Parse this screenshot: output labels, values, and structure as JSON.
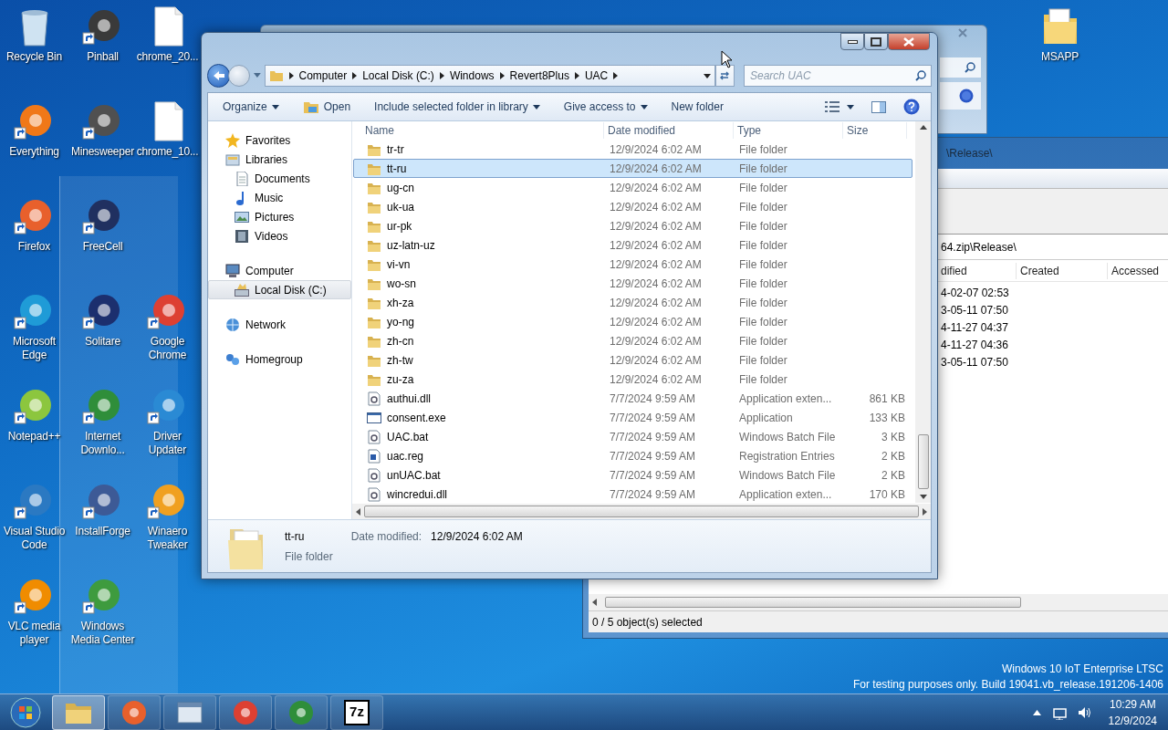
{
  "desktop_icon_columns": [
    [
      {
        "label": "Recycle Bin",
        "kind": "bin",
        "shortcut": false
      },
      {
        "label": "Everything",
        "kind": "app",
        "color": "#f07818",
        "shortcut": true
      },
      {
        "label": "Firefox",
        "kind": "app",
        "color": "#e8602c",
        "shortcut": true
      },
      {
        "label": "Microsoft Edge",
        "kind": "app",
        "color": "#1f9bd7",
        "shortcut": true
      },
      {
        "label": "Notepad++",
        "kind": "app",
        "color": "#8cc63e",
        "shortcut": true
      },
      {
        "label": "Visual Studio Code",
        "kind": "app",
        "color": "#2b79c2",
        "shortcut": true
      },
      {
        "label": "VLC media player",
        "kind": "app",
        "color": "#f08c00",
        "shortcut": true
      }
    ],
    [
      {
        "label": "Pinball",
        "kind": "app",
        "color": "#3a3a3a",
        "shortcut": true
      },
      {
        "label": "Minesweeper",
        "kind": "app",
        "color": "#505050",
        "shortcut": true
      },
      {
        "label": "FreeCell",
        "kind": "app",
        "color": "#203060",
        "shortcut": true
      },
      {
        "label": "Solitare",
        "kind": "app",
        "color": "#1c2f6e",
        "shortcut": true
      },
      {
        "label": "Internet Downlo...",
        "kind": "app",
        "color": "#2f8e3a",
        "shortcut": true
      },
      {
        "label": "InstallForge",
        "kind": "app",
        "color": "#3d5a96",
        "shortcut": true
      },
      {
        "label": "Windows Media Center",
        "kind": "app",
        "color": "#3e9b3e",
        "shortcut": true
      }
    ],
    [
      {
        "label": "chrome_20...",
        "kind": "file",
        "shortcut": false
      },
      {
        "label": "chrome_10...",
        "kind": "file",
        "shortcut": false
      },
      {
        "label": "Google Chrome",
        "kind": "app",
        "color": "#dd4032",
        "shortcut": true
      },
      {
        "label": "Driver Updater",
        "kind": "app",
        "color": "#2a8ad4",
        "shortcut": true
      },
      {
        "label": "Winaero Tweaker",
        "kind": "app",
        "color": "#f0a020",
        "shortcut": true
      }
    ]
  ],
  "desktop_icon_right": {
    "label": "MSAPP",
    "kind": "folder",
    "shortcut": false
  },
  "archive_window": {
    "title": "\\Release\\",
    "path": "64.zip\\Release\\",
    "columns": [
      "dified",
      "Created",
      "Accessed"
    ],
    "rows": [
      "4-02-07 02:53",
      "3-05-11 07:50",
      "4-11-27 04:37",
      "4-11-27 04:36",
      "3-05-11 07:50"
    ],
    "status": "0 / 5 object(s) selected"
  },
  "explorer": {
    "breadcrumbs": [
      "Computer",
      "Local Disk (C:)",
      "Windows",
      "Revert8Plus",
      "UAC"
    ],
    "search": {
      "placeholder": "Search UAC"
    },
    "toolbar": [
      {
        "label": "Organize",
        "dropdown": true,
        "icon": false
      },
      {
        "label": "Open",
        "dropdown": false,
        "icon": true
      },
      {
        "label": "Include selected folder in library",
        "dropdown": true,
        "icon": false
      },
      {
        "label": "Give access to",
        "dropdown": true,
        "icon": false
      },
      {
        "label": "New folder",
        "dropdown": false,
        "icon": false
      }
    ],
    "nav": [
      {
        "label": "Favorites",
        "kind": "star",
        "selected": false
      },
      {
        "label": "Libraries",
        "kind": "library",
        "selected": false,
        "children": [
          {
            "label": "Documents",
            "kind": "document",
            "selected": false
          },
          {
            "label": "Music",
            "kind": "music",
            "selected": false
          },
          {
            "label": "Pictures",
            "kind": "picture",
            "selected": false
          },
          {
            "label": "Videos",
            "kind": "video",
            "selected": false
          }
        ]
      },
      {
        "label": "Computer",
        "kind": "computer",
        "selected": false,
        "children": [
          {
            "label": "Local Disk (C:)",
            "kind": "disk",
            "selected": true
          }
        ]
      },
      {
        "label": "Network",
        "kind": "network",
        "selected": false
      },
      {
        "label": "Homegroup",
        "kind": "homegroup",
        "selected": false
      }
    ],
    "columns": [
      "Name",
      "Date modified",
      "Type",
      "Size"
    ],
    "rows": [
      {
        "name": "tr-tr",
        "date": "12/9/2024 6:02 AM",
        "type": "File folder",
        "kind": "folder",
        "selected": false
      },
      {
        "name": "tt-ru",
        "date": "12/9/2024 6:02 AM",
        "type": "File folder",
        "kind": "folder",
        "selected": true
      },
      {
        "name": "ug-cn",
        "date": "12/9/2024 6:02 AM",
        "type": "File folder",
        "kind": "folder",
        "selected": false
      },
      {
        "name": "uk-ua",
        "date": "12/9/2024 6:02 AM",
        "type": "File folder",
        "kind": "folder",
        "selected": false
      },
      {
        "name": "ur-pk",
        "date": "12/9/2024 6:02 AM",
        "type": "File folder",
        "kind": "folder",
        "selected": false
      },
      {
        "name": "uz-latn-uz",
        "date": "12/9/2024 6:02 AM",
        "type": "File folder",
        "kind": "folder",
        "selected": false
      },
      {
        "name": "vi-vn",
        "date": "12/9/2024 6:02 AM",
        "type": "File folder",
        "kind": "folder",
        "selected": false
      },
      {
        "name": "wo-sn",
        "date": "12/9/2024 6:02 AM",
        "type": "File folder",
        "kind": "folder",
        "selected": false
      },
      {
        "name": "xh-za",
        "date": "12/9/2024 6:02 AM",
        "type": "File folder",
        "kind": "folder",
        "selected": false
      },
      {
        "name": "yo-ng",
        "date": "12/9/2024 6:02 AM",
        "type": "File folder",
        "kind": "folder",
        "selected": false
      },
      {
        "name": "zh-cn",
        "date": "12/9/2024 6:02 AM",
        "type": "File folder",
        "kind": "folder",
        "selected": false
      },
      {
        "name": "zh-tw",
        "date": "12/9/2024 6:02 AM",
        "type": "File folder",
        "kind": "folder",
        "selected": false
      },
      {
        "name": "zu-za",
        "date": "12/9/2024 6:02 AM",
        "type": "File folder",
        "kind": "folder",
        "selected": false
      },
      {
        "name": "authui.dll",
        "date": "7/7/2024 9:59 AM",
        "type": "Application exten...",
        "size": "861 KB",
        "kind": "gear-file",
        "selected": false
      },
      {
        "name": "consent.exe",
        "date": "7/7/2024 9:59 AM",
        "type": "Application",
        "size": "133 KB",
        "kind": "app-window",
        "selected": false
      },
      {
        "name": "UAC.bat",
        "date": "7/7/2024 9:59 AM",
        "type": "Windows Batch File",
        "size": "3 KB",
        "kind": "gear-file",
        "selected": false
      },
      {
        "name": "uac.reg",
        "date": "7/7/2024 9:59 AM",
        "type": "Registration Entries",
        "size": "2 KB",
        "kind": "reg-file",
        "selected": false
      },
      {
        "name": "unUAC.bat",
        "date": "7/7/2024 9:59 AM",
        "type": "Windows Batch File",
        "size": "2 KB",
        "kind": "gear-file",
        "selected": false
      },
      {
        "name": "wincredui.dll",
        "date": "7/7/2024 9:59 AM",
        "type": "Application exten...",
        "size": "170 KB",
        "kind": "gear-file",
        "selected": false
      }
    ],
    "details": {
      "name": "tt-ru",
      "type": "File folder",
      "date_label": "Date modified:",
      "date": "12/9/2024 6:02 AM"
    }
  },
  "os_notice": [
    "Windows 10 IoT Enterprise LTSC",
    "For testing purposes only. Build 19041.vb_release.191206-1406"
  ],
  "taskbar": {
    "buttons": [
      {
        "kind": "folder",
        "selected": true
      },
      {
        "kind": "app",
        "color": "#e8602c",
        "selected": false
      },
      {
        "kind": "window",
        "selected": false
      },
      {
        "kind": "app",
        "color": "#dd4032",
        "selected": false
      },
      {
        "kind": "app",
        "color": "#2f8e3a",
        "selected": false
      },
      {
        "kind": "text",
        "label": "7z",
        "selected": false
      }
    ],
    "time": "10:29 AM",
    "date": "12/9/2024"
  }
}
